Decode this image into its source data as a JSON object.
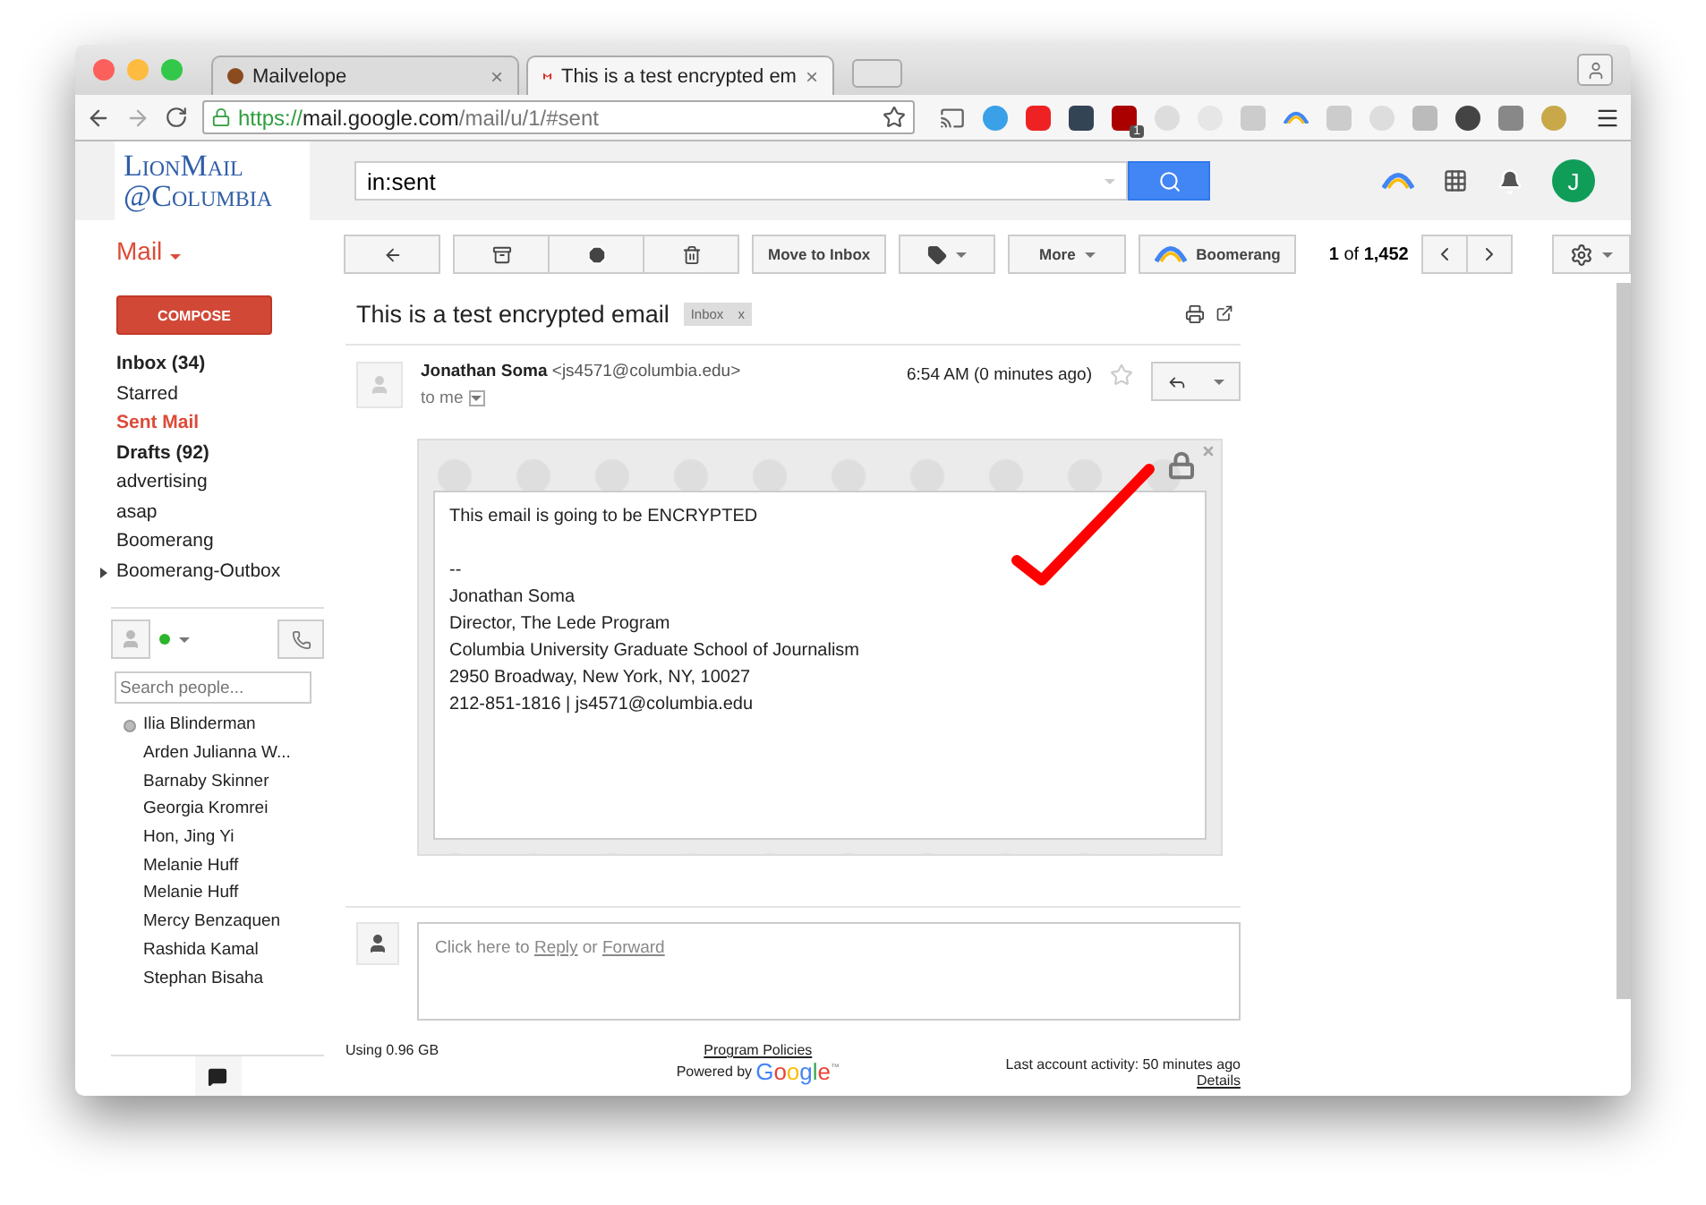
{
  "browser": {
    "tabs": [
      {
        "title": "Mailvelope",
        "selected": false,
        "close": "×"
      },
      {
        "title": "This is a test encrypted em",
        "selected": true,
        "close": "×"
      }
    ],
    "url": {
      "scheme": "https://",
      "host": "mail.google.com",
      "path": "/mail/u/1/#sent"
    },
    "extension_badge": "1"
  },
  "header": {
    "logo_line1": "LionMail",
    "logo_line2": "@Columbia",
    "search_value": "in:sent",
    "avatar_letter": "J"
  },
  "toolbar": {
    "mail_label": "Mail",
    "move_to_inbox": "Move to Inbox",
    "more": "More",
    "boomerang": "Boomerang",
    "pager": "**1** of **1,452**"
  },
  "sidebar": {
    "compose": "COMPOSE",
    "folders": [
      {
        "label": "Inbox (34)",
        "bold": true,
        "selected": false,
        "expandable": false
      },
      {
        "label": "Starred",
        "bold": false,
        "selected": false,
        "expandable": false
      },
      {
        "label": "Sent Mail",
        "bold": true,
        "selected": true,
        "expandable": false
      },
      {
        "label": "Drafts (92)",
        "bold": true,
        "selected": false,
        "expandable": false
      },
      {
        "label": "advertising",
        "bold": false,
        "selected": false,
        "expandable": false
      },
      {
        "label": "asap",
        "bold": false,
        "selected": false,
        "expandable": false
      },
      {
        "label": "Boomerang",
        "bold": false,
        "selected": false,
        "expandable": false
      },
      {
        "label": "Boomerang-Outbox",
        "bold": false,
        "selected": false,
        "expandable": true
      }
    ],
    "chat": {
      "online": true,
      "search_placeholder": "Search people...",
      "contacts": [
        {
          "name": "Ilia Blinderman",
          "status_dot": true
        },
        {
          "name": "Arden Julianna W...",
          "status_dot": false
        },
        {
          "name": "Barnaby Skinner",
          "status_dot": false
        },
        {
          "name": "Georgia Kromrei",
          "status_dot": false
        },
        {
          "name": "Hon, Jing Yi",
          "status_dot": false
        },
        {
          "name": "Melanie Huff",
          "status_dot": false
        },
        {
          "name": "Melanie Huff",
          "status_dot": false
        },
        {
          "name": "Mercy Benzaquen",
          "status_dot": false
        },
        {
          "name": "Rashida Kamal",
          "status_dot": false
        },
        {
          "name": "Stephan Bisaha",
          "status_dot": false
        }
      ]
    }
  },
  "message": {
    "subject": "This is a test encrypted email",
    "label": "Inbox",
    "label_close": "x",
    "sender_name": "Jonathan Soma",
    "sender_email": "<js4571@columbia.edu>",
    "time": "6:54 AM (0 minutes ago)",
    "starred": false,
    "recipient": "to me",
    "body": [
      "This email is going to be ENCRYPTED"
    ],
    "signature": [
      "--",
      "Jonathan Soma",
      "Director, The Lede Program",
      "Columbia University Graduate School of Journalism",
      "2950 Broadway, New York, NY, 10027",
      "212-851-1816 | js4571@columbia.edu"
    ]
  },
  "reply_box": {
    "prefix": "Click here to",
    "reply": "Reply",
    "middle": "or",
    "forward": "Forward"
  },
  "footer": {
    "storage": "Using 0.96 GB",
    "policies": "Program Policies",
    "powered_by": "Powered by",
    "google": "Google",
    "tm": "™",
    "activity": "Last account activity: 50 minutes ago",
    "details": "Details"
  }
}
